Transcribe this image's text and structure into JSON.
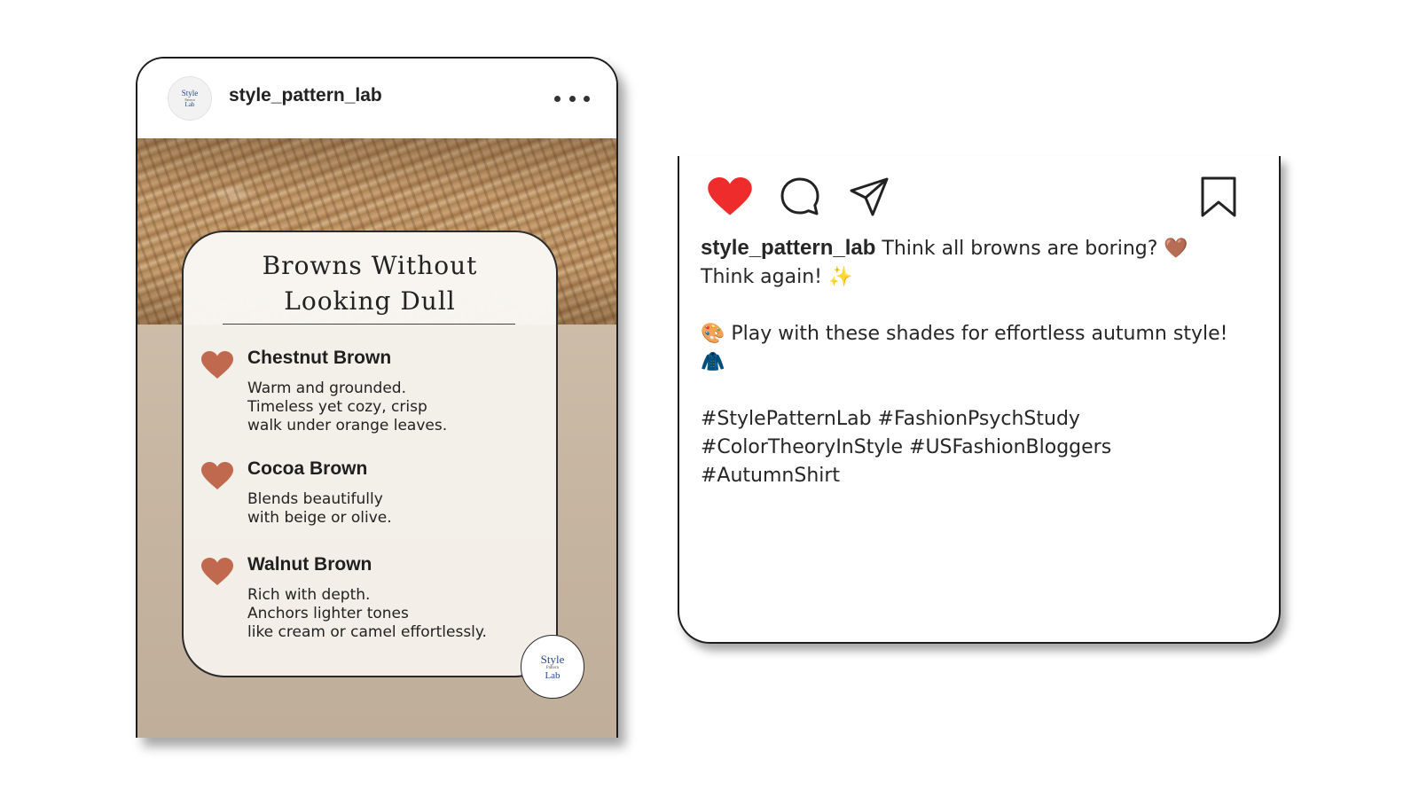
{
  "post": {
    "username": "style_pattern_lab",
    "avatar_logo": {
      "line1": "Style",
      "line2": "Pattern",
      "line3": "Lab"
    },
    "more_icon": "more-horizontal-icon",
    "card": {
      "title_line1": "Browns Without",
      "title_line2": "Looking Dull",
      "items": [
        {
          "name": "Chestnut Brown",
          "desc": [
            "Warm and grounded.",
            "Timeless yet cozy, crisp",
            "walk under orange leaves."
          ]
        },
        {
          "name": "Cocoa Brown",
          "desc": [
            "Blends beautifully",
            "with beige or olive."
          ]
        },
        {
          "name": "Walnut Brown",
          "desc": [
            "Rich with depth.",
            "Anchors lighter tones",
            "like cream or camel effortlessly."
          ]
        }
      ],
      "heart_color": "#c0694e"
    },
    "badge_logo": {
      "line1": "Style",
      "line2": "Pattern",
      "line3": "Lab"
    }
  },
  "caption_card": {
    "icons": {
      "like": "heart-filled-icon",
      "comment": "comment-icon",
      "share": "send-icon",
      "save": "bookmark-icon"
    },
    "like_color": "#ef2c2c",
    "username": "style_pattern_lab",
    "line1": "Think all browns are boring? 🤎",
    "line2": "Think again! ✨",
    "line3": "🎨 Play with these shades for effortless autumn style!",
    "line4": "🧥",
    "hashtags_line1": [
      "#StylePatternLab",
      "#FashionPsychStudy"
    ],
    "hashtags_line2": [
      "#ColorTheoryInStyle",
      "#USFashionBloggers"
    ],
    "hashtags_line3": [
      "#AutumnShirt"
    ]
  }
}
